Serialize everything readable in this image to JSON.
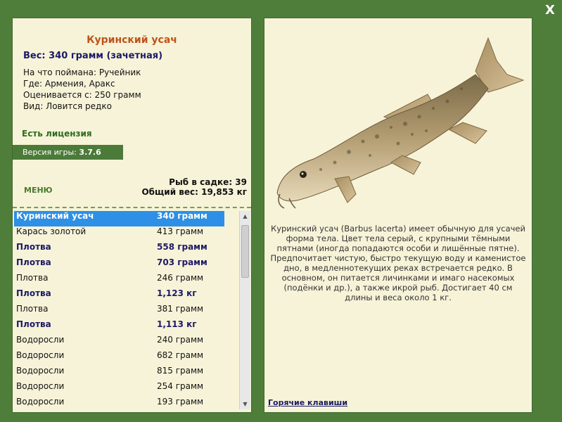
{
  "close_label": "X",
  "fish": {
    "title": "Куринский усач",
    "weight_line": "Вес: 340 грамм (зачетная)",
    "info": [
      "На что поймана: Ручейник",
      "Где: Армения, Аракс",
      "Оценивается с: 250 грамм",
      "Вид: Ловится редко"
    ],
    "license": "Есть лицензия",
    "version_label": "Версия игры:",
    "version_value": "3.7.6",
    "menu": "МЕНЮ",
    "stats": {
      "count": "Рыб в садке: 39",
      "total": "Общий вес: 19,853 кг"
    },
    "description": "Куринский усач (Barbus lacerta) имеет обычную для усачей форма тела. Цвет тела серый, с крупными тёмными пятнами (иногда попадаются особи и лишённые пятне). Предпочитает чистую, быстро текущую воду и каменистое дно, в медленнотекущих реках встречается редко. В основном, он питается личинками и имаго насекомых (подёнки и др.), а также икрой рыб. Достигает 40 см длины и веса около 1 кг.",
    "hotkeys": "Горячие клавиши"
  },
  "catch_list": [
    {
      "name": "Куринский усач",
      "weight": "340 грамм",
      "style": "sel"
    },
    {
      "name": "Карась золотой",
      "weight": "413 грамм",
      "style": ""
    },
    {
      "name": "Плотва",
      "weight": "558 грамм",
      "style": "bold"
    },
    {
      "name": "Плотва",
      "weight": "703 грамм",
      "style": "bold"
    },
    {
      "name": "Плотва",
      "weight": "246 грамм",
      "style": ""
    },
    {
      "name": "Плотва",
      "weight": "1,123 кг",
      "style": "bold"
    },
    {
      "name": "Плотва",
      "weight": "381 грамм",
      "style": ""
    },
    {
      "name": "Плотва",
      "weight": "1,113 кг",
      "style": "bold"
    },
    {
      "name": "Водоросли",
      "weight": "240 грамм",
      "style": ""
    },
    {
      "name": "Водоросли",
      "weight": "682 грамм",
      "style": ""
    },
    {
      "name": "Водоросли",
      "weight": "815 грамм",
      "style": ""
    },
    {
      "name": "Водоросли",
      "weight": "254 грамм",
      "style": ""
    },
    {
      "name": "Водоросли",
      "weight": "193 грамм",
      "style": ""
    }
  ],
  "scrollbar": {
    "up_icon": "▲",
    "down_icon": "▼"
  },
  "colors": {
    "background": "#4f7d3a",
    "panel": "#f7f3d9",
    "title": "#c0521a",
    "accent_text": "#1c1a66",
    "selection": "#2e8fe6"
  }
}
